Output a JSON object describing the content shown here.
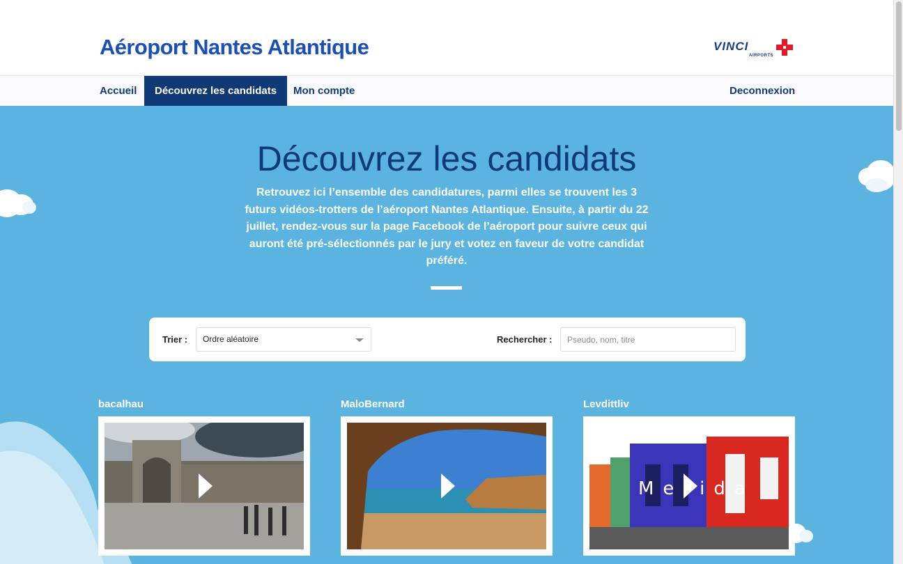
{
  "header": {
    "site_title": "Aéroport Nantes Atlantique",
    "logo_text": "VINCI",
    "logo_sub": "AIRPORTS"
  },
  "nav": {
    "items": [
      {
        "label": "Accueil",
        "active": false
      },
      {
        "label": "Découvrez les candidats",
        "active": true
      },
      {
        "label": "Mon compte",
        "active": false
      }
    ],
    "logout_label": "Deconnexion"
  },
  "hero": {
    "title": "Découvrez les candidats",
    "intro": "Retrouvez ici l’ensemble des candidatures, parmi elles se trouvent les 3 futurs vidéos-trotters de l’aéroport Nantes Atlantique. Ensuite, à partir du 22 juillet, rendez-vous sur la page Facebook de l’aéroport pour suivre ceux qui auront été pré-sélectionnés par le jury et votez en faveur de votre candidat préféré."
  },
  "filters": {
    "sort_label": "Trier :",
    "sort_value": "Ordre aléatoire",
    "search_label": "Rechercher :",
    "search_placeholder": "Pseudo, nom, titre"
  },
  "candidates": [
    {
      "name": "bacalhau"
    },
    {
      "name": "MaloBernard"
    },
    {
      "name": "Levdittliv",
      "overlay_text": "Merida"
    }
  ],
  "colors": {
    "brand_blue": "#1a4fb8",
    "nav_dark": "#103a75",
    "hero_bg": "#5bb4e0",
    "vinci_red": "#e2182b"
  }
}
